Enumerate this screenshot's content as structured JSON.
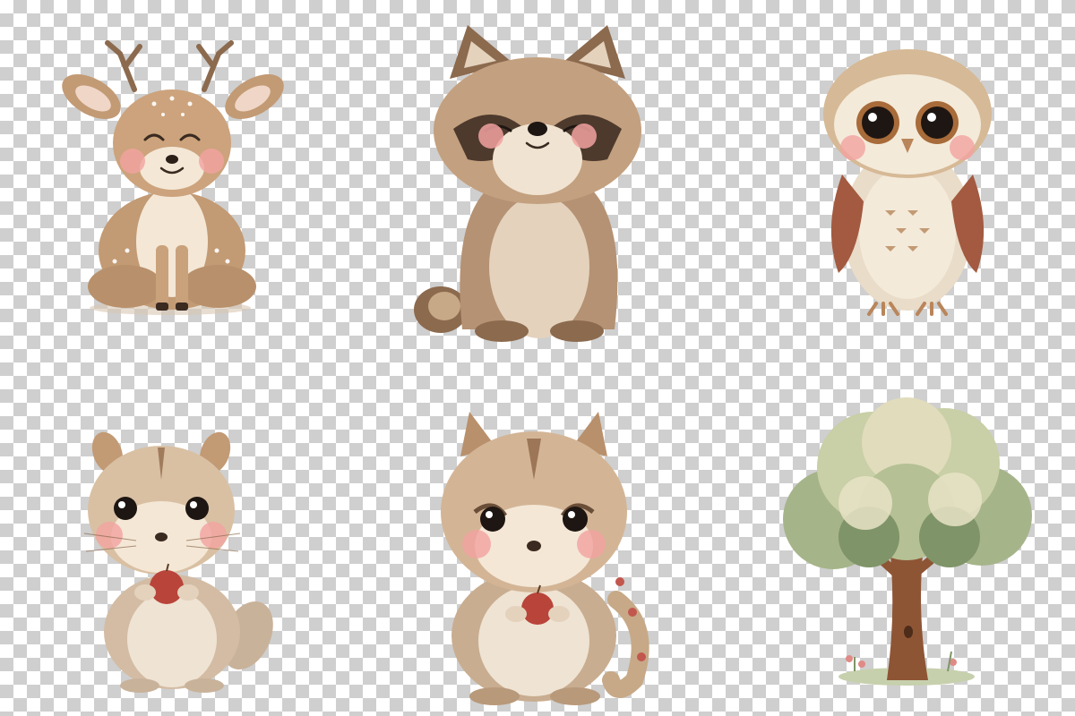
{
  "canvas": {
    "background": "transparency-checkerboard"
  },
  "palette": {
    "fur_light": "#d9c0a3",
    "fur_mid": "#c29a74",
    "fur_dark": "#8c6a4e",
    "cream": "#f4e7d6",
    "blush": "#f2a2a0",
    "eye": "#1e1612",
    "apple": "#b9443a",
    "leaf_light": "#dcdcb8",
    "leaf_mid": "#a6b48a",
    "leaf_dark": "#7f9468",
    "bark": "#8e5535"
  },
  "illustrations": [
    {
      "id": "deer",
      "icon": "fawn-illustration"
    },
    {
      "id": "raccoon",
      "icon": "raccoon-illustration"
    },
    {
      "id": "owl",
      "icon": "owl-illustration"
    },
    {
      "id": "chipmunk",
      "icon": "chipmunk-with-apple-illustration"
    },
    {
      "id": "squirrel",
      "icon": "squirrel-with-apple-illustration"
    },
    {
      "id": "tree",
      "icon": "tree-illustration"
    }
  ]
}
